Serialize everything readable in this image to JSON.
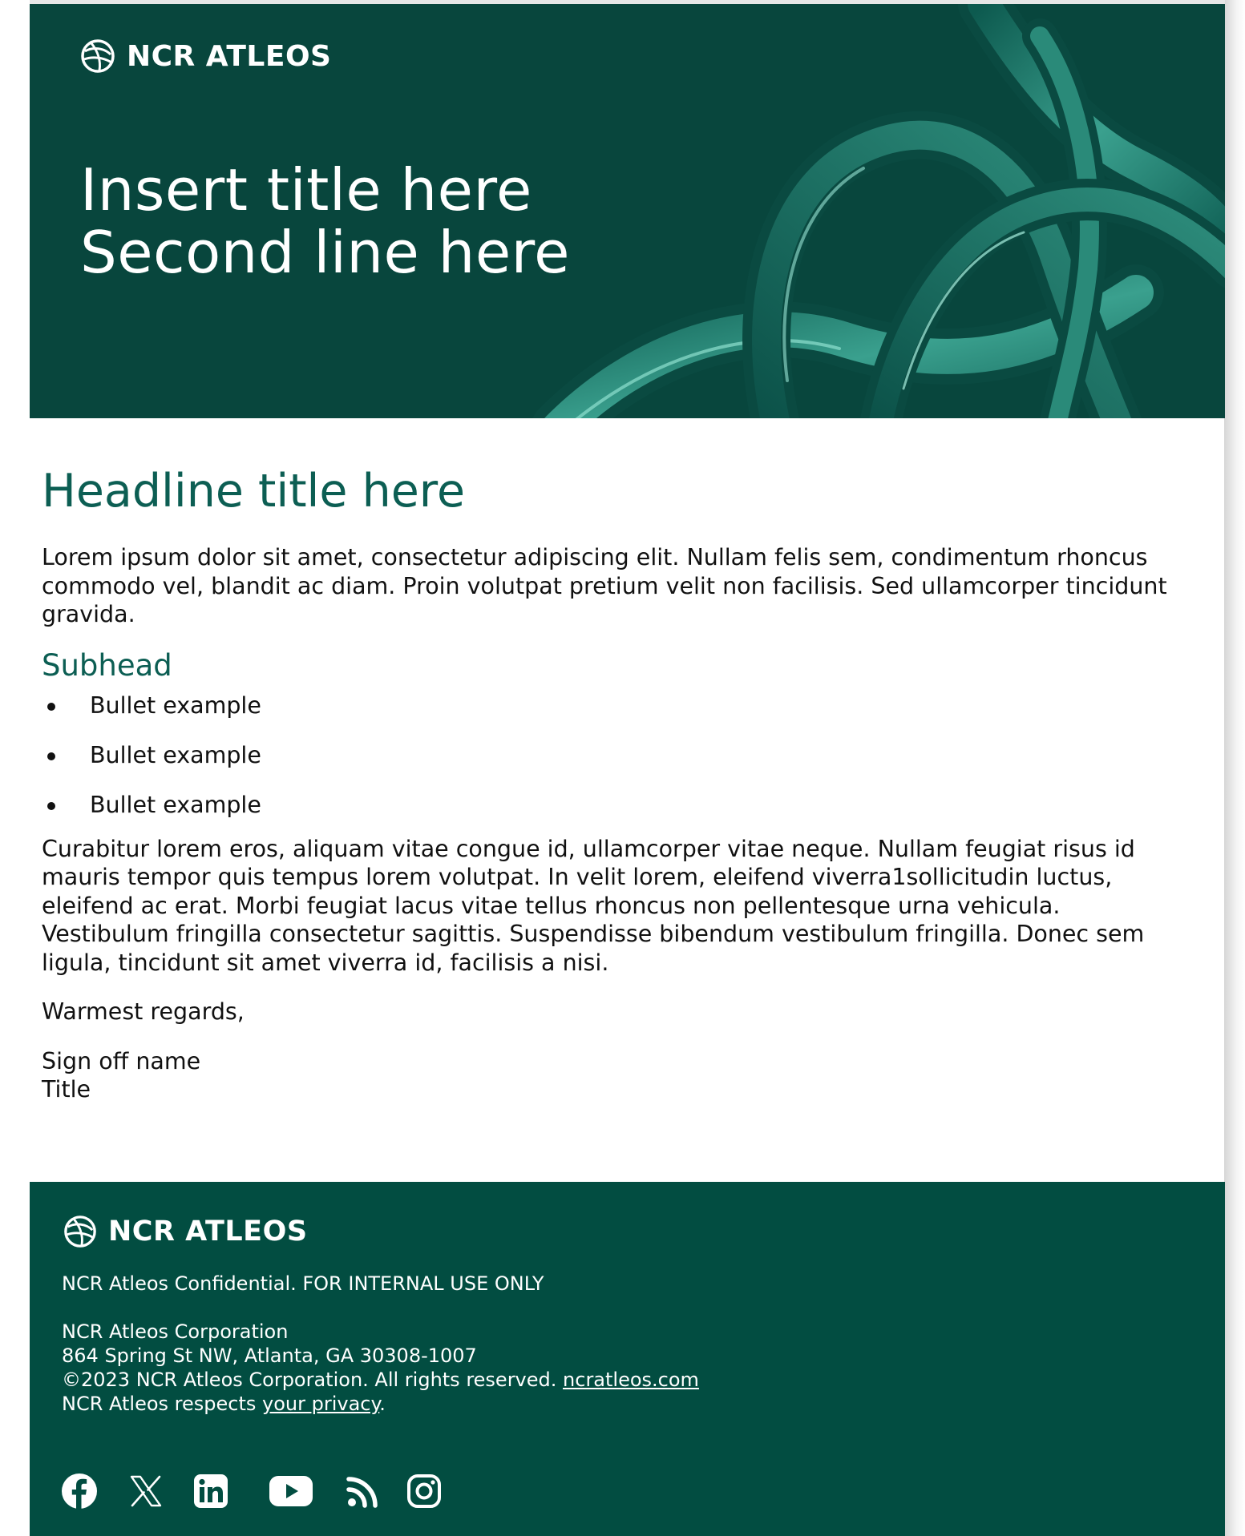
{
  "brand": {
    "name": "NCR ATLEOS",
    "color_primary": "#08463d",
    "color_footer": "#024d41",
    "color_accent_text": "#0c5e53"
  },
  "banner": {
    "title_line1": "Insert title here",
    "title_line2": "Second line here"
  },
  "body": {
    "headline": "Headline title here",
    "paragraph1": "Lorem ipsum dolor sit amet, consectetur adipiscing elit. Nullam felis sem, condimentum rhoncus commodo vel, blandit ac diam. Proin volutpat pretium velit non facilisis. Sed ullamcorper tincidunt gravida.",
    "subhead": "Subhead",
    "bullets": [
      "Bullet example",
      "Bullet example",
      "Bullet example"
    ],
    "paragraph2": "Curabitur lorem eros, aliquam vitae congue id, ullamcorper vitae neque. Nullam feugiat risus id mauris tempor quis tempus lorem volutpat. In velit lorem, eleifend viverra1sollicitudin luctus, eleifend ac erat. Morbi feugiat lacus vitae tellus rhoncus non pellentesque urna vehicula. Vestibulum fringilla consectetur sagittis. Suspendisse bibendum vestibulum fringilla. Donec sem ligula, tincidunt sit amet viverra id, facilisis a nisi.",
    "regards": "Warmest regards,",
    "signoff_name": "Sign off name",
    "signoff_title": "Title"
  },
  "footer": {
    "confidential": "NCR Atleos Confidential. FOR INTERNAL USE ONLY",
    "company": "NCR Atleos Corporation",
    "address": "864 Spring St NW, Atlanta, GA 30308-1007",
    "copyright": "©2023 NCR Atleos Corporation. All rights reserved.",
    "website_link": "ncratleos.com",
    "privacy_prefix": "NCR Atleos respects",
    "privacy_link": "your privacy",
    "privacy_suffix": ".",
    "social_icons": [
      "facebook-icon",
      "x-icon",
      "linkedin-icon",
      "youtube-icon",
      "rss-icon",
      "instagram-icon"
    ]
  }
}
